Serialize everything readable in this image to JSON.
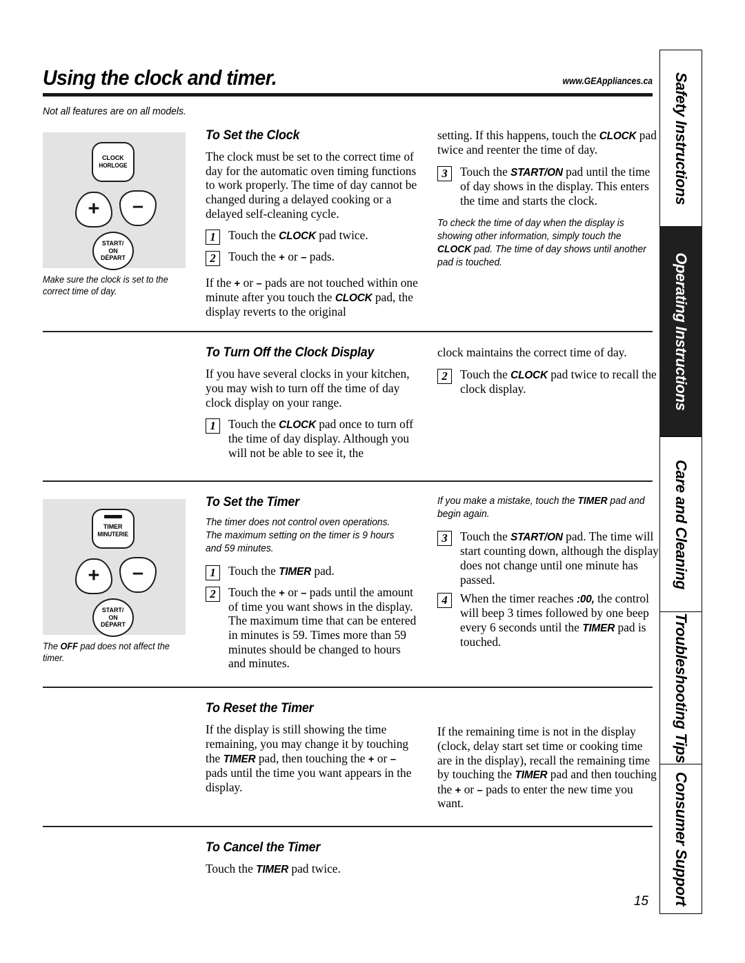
{
  "header": {
    "title": "Using the clock and timer.",
    "url": "www.GEAppliances.ca",
    "subnote": "Not all features are on all models."
  },
  "figures": {
    "clock": {
      "pad_line1": "CLOCK",
      "pad_line2": "HORLOGE",
      "plus": "+",
      "minus": "–",
      "start_line1": "START/",
      "start_line2": "ON",
      "start_line3": "DÉPART",
      "caption": "Make sure the clock is set to the correct time of day."
    },
    "timer": {
      "pad_line1": "TIMER",
      "pad_line2": "MINUTERIE",
      "plus": "+",
      "minus": "–",
      "start_line1": "START/",
      "start_line2": "ON",
      "start_line3": "DÉPART",
      "caption_pre": "The ",
      "caption_bold": "OFF",
      "caption_post": " pad does not affect the timer."
    }
  },
  "sections": {
    "set_clock": {
      "heading": "To Set the Clock",
      "intro": "The clock must be set to the correct time of day for the automatic oven timing functions to work properly. The time of day cannot be changed during a delayed cooking or a delayed self-cleaning cycle.",
      "step1_num": "1",
      "step1_pre": "Touch the ",
      "step1_pad": "CLOCK",
      "step1_post": " pad twice.",
      "step2_num": "2",
      "step2_pre": "Touch the ",
      "step2_plus": "+",
      "step2_mid": " or ",
      "step2_minus": "–",
      "step2_post": " pads.",
      "after_pre": "If the ",
      "after_plus": "+",
      "after_mid": " or ",
      "after_minus": "–",
      "after_mid2": " pads are not touched within one minute after you touch the ",
      "after_pad": "CLOCK",
      "after_post": " pad, the display reverts to the original",
      "right_cont_pre": "setting. If this happens, touch the ",
      "right_cont_pad": "CLOCK",
      "right_cont_post": " pad twice and reenter the time of day.",
      "step3_num": "3",
      "step3_pre": "Touch the ",
      "step3_pad": "START/ON",
      "step3_post": " pad until the time of day shows in the display. This enters the time and starts the clock.",
      "note_pre": "To check the time of day when the display is showing other information, simply touch the ",
      "note_pad": "CLOCK",
      "note_post": " pad. The time of day shows until another pad is touched."
    },
    "turn_off_clock": {
      "heading": "To Turn Off the Clock Display",
      "intro": "If you have several clocks in your kitchen, you may wish to turn off the time of day clock display on your range.",
      "step1_num": "1",
      "step1_pre": "Touch the ",
      "step1_pad": "CLOCK",
      "step1_post": " pad once to turn off the time of day display. Although you will not be able to see it, the",
      "right_cont": "clock maintains the correct time of day.",
      "step2_num": "2",
      "step2_pre": "Touch the ",
      "step2_pad": "CLOCK",
      "step2_post": " pad twice to recall the clock display."
    },
    "set_timer": {
      "heading": "To Set the Timer",
      "note_left": "The timer does not control oven operations. The maximum setting on the timer is 9 hours and 59 minutes.",
      "step1_num": "1",
      "step1_pre": "Touch the ",
      "step1_pad": "TIMER",
      "step1_post": " pad.",
      "step2_num": "2",
      "step2_pre": "Touch the ",
      "step2_plus": "+",
      "step2_mid": " or ",
      "step2_minus": "–",
      "step2_post": " pads until the amount of time you want shows in the display. The maximum time that can be entered in minutes is 59. Times more than 59 minutes should be changed to hours and minutes.",
      "note_right_pre": "If you make a mistake, touch the ",
      "note_right_pad": "TIMER",
      "note_right_post": " pad and begin again.",
      "step3_num": "3",
      "step3_pre": "Touch the ",
      "step3_pad": "START/ON",
      "step3_post": " pad. The time will start counting down, although the display does not change until one minute has passed.",
      "step4_num": "4",
      "step4_pre": "When the timer reaches ",
      "step4_val": ":00,",
      "step4_mid": " the control will beep 3 times followed by one beep every 6 seconds until the ",
      "step4_pad": "TIMER",
      "step4_post": " pad is touched."
    },
    "reset_timer": {
      "heading": "To Reset the Timer",
      "left_pre": "If the display is still showing the time remaining, you may change it by touching the ",
      "left_pad": "TIMER",
      "left_mid": " pad, then touching the ",
      "left_plus": "+",
      "left_mid2": " or ",
      "left_minus": "–",
      "left_post": " pads until the time you want appears in the display.",
      "right_pre": "If the remaining time is not in the display (clock, delay start set time or cooking time are in the display), recall the remaining time by touching the ",
      "right_pad": "TIMER",
      "right_mid": " pad and then touching the ",
      "right_plus": "+",
      "right_mid2": " or ",
      "right_minus": "–",
      "right_post": " pads to enter the new time you want."
    },
    "cancel_timer": {
      "heading": "To Cancel the Timer",
      "text_pre": "Touch the ",
      "text_pad": "TIMER",
      "text_post": " pad twice."
    }
  },
  "sidetabs": [
    {
      "label": "Safety Instructions",
      "active": false
    },
    {
      "label": "Operating Instructions",
      "active": true
    },
    {
      "label": "Care and Cleaning",
      "active": false
    },
    {
      "label": "Troubleshooting Tips",
      "active": false
    },
    {
      "label": "Consumer Support",
      "active": false
    }
  ],
  "page_number": "15"
}
